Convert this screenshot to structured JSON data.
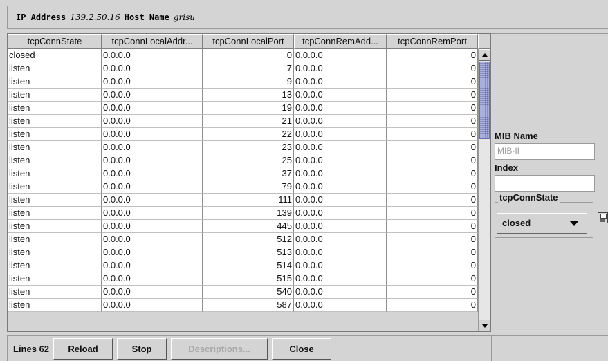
{
  "header": {
    "ip_label": "IP Address",
    "ip_value": "139.2.50.16",
    "host_label": "Host Name",
    "host_value": "grisu"
  },
  "table": {
    "columns": [
      "tcpConnState",
      "tcpConnLocalAddr...",
      "tcpConnLocalPort",
      "tcpConnRemAdd...",
      "tcpConnRemPort"
    ],
    "rows": [
      [
        "closed",
        "0.0.0.0",
        "0",
        "0.0.0.0",
        "0"
      ],
      [
        "listen",
        "0.0.0.0",
        "7",
        "0.0.0.0",
        "0"
      ],
      [
        "listen",
        "0.0.0.0",
        "9",
        "0.0.0.0",
        "0"
      ],
      [
        "listen",
        "0.0.0.0",
        "13",
        "0.0.0.0",
        "0"
      ],
      [
        "listen",
        "0.0.0.0",
        "19",
        "0.0.0.0",
        "0"
      ],
      [
        "listen",
        "0.0.0.0",
        "21",
        "0.0.0.0",
        "0"
      ],
      [
        "listen",
        "0.0.0.0",
        "22",
        "0.0.0.0",
        "0"
      ],
      [
        "listen",
        "0.0.0.0",
        "23",
        "0.0.0.0",
        "0"
      ],
      [
        "listen",
        "0.0.0.0",
        "25",
        "0.0.0.0",
        "0"
      ],
      [
        "listen",
        "0.0.0.0",
        "37",
        "0.0.0.0",
        "0"
      ],
      [
        "listen",
        "0.0.0.0",
        "79",
        "0.0.0.0",
        "0"
      ],
      [
        "listen",
        "0.0.0.0",
        "111",
        "0.0.0.0",
        "0"
      ],
      [
        "listen",
        "0.0.0.0",
        "139",
        "0.0.0.0",
        "0"
      ],
      [
        "listen",
        "0.0.0.0",
        "445",
        "0.0.0.0",
        "0"
      ],
      [
        "listen",
        "0.0.0.0",
        "512",
        "0.0.0.0",
        "0"
      ],
      [
        "listen",
        "0.0.0.0",
        "513",
        "0.0.0.0",
        "0"
      ],
      [
        "listen",
        "0.0.0.0",
        "514",
        "0.0.0.0",
        "0"
      ],
      [
        "listen",
        "0.0.0.0",
        "515",
        "0.0.0.0",
        "0"
      ],
      [
        "listen",
        "0.0.0.0",
        "540",
        "0.0.0.0",
        "0"
      ],
      [
        "listen",
        "0.0.0.0",
        "587",
        "0.0.0.0",
        "0"
      ]
    ]
  },
  "panel": {
    "mib_name_label": "MIB Name",
    "mib_name_placeholder": "MIB-II",
    "index_label": "Index",
    "index_value": "",
    "group_title": "tcpConnState",
    "state_selected": "closed"
  },
  "footer": {
    "lines_label": "Lines 62",
    "reload_label": "Reload",
    "stop_label": "Stop",
    "descriptions_label": "Descriptions...",
    "close_label": "Close"
  }
}
